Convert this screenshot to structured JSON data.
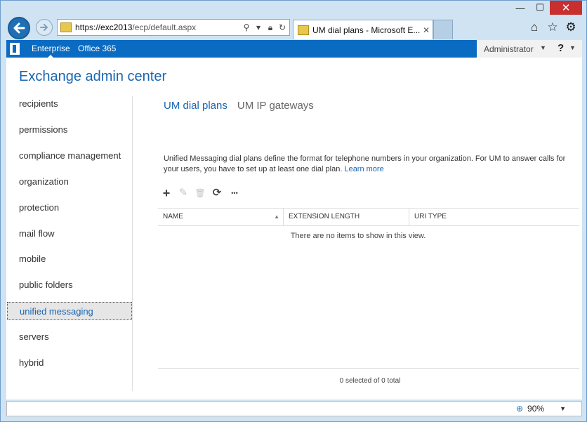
{
  "browser": {
    "window_controls": {
      "minimize": "—",
      "maximize": "☐",
      "close": "✕"
    },
    "address_bar": {
      "protocol": "https://",
      "host": "exc2013",
      "path": "/ecp/default.aspx"
    },
    "tab": {
      "title": "UM dial plans - Microsoft E...",
      "close": "✕"
    },
    "toolbar_icons": [
      "home-icon",
      "star-icon",
      "gear-icon"
    ],
    "status": {
      "zoom": "90%"
    }
  },
  "topbar": {
    "enterprise": "Enterprise",
    "office365": "Office 365",
    "user": "Administrator",
    "help": "?"
  },
  "app_title": "Exchange admin center",
  "sidebar": {
    "items": [
      {
        "label": "recipients",
        "selected": false
      },
      {
        "label": "permissions",
        "selected": false
      },
      {
        "label": "compliance management",
        "selected": false
      },
      {
        "label": "organization",
        "selected": false
      },
      {
        "label": "protection",
        "selected": false
      },
      {
        "label": "mail flow",
        "selected": false
      },
      {
        "label": "mobile",
        "selected": false
      },
      {
        "label": "public folders",
        "selected": false
      },
      {
        "label": "unified messaging",
        "selected": true
      },
      {
        "label": "servers",
        "selected": false
      },
      {
        "label": "hybrid",
        "selected": false
      }
    ]
  },
  "main": {
    "tabs": [
      {
        "label": "UM dial plans",
        "active": true
      },
      {
        "label": "UM IP gateways",
        "active": false
      }
    ],
    "description": "Unified Messaging dial plans define the format for telephone numbers in your organization. For UM to answer calls for your users, you have to set up at least one dial plan.",
    "learn_more": "Learn more",
    "toolbar": [
      {
        "name": "add-icon",
        "glyph": "+",
        "enabled": true
      },
      {
        "name": "edit-icon",
        "glyph": "✎",
        "enabled": false
      },
      {
        "name": "delete-icon",
        "glyph": "🗑",
        "enabled": false
      },
      {
        "name": "refresh-icon",
        "glyph": "⟳",
        "enabled": true
      },
      {
        "name": "more-icon",
        "glyph": "•••",
        "enabled": true
      }
    ],
    "grid": {
      "columns": [
        "NAME",
        "EXTENSION LENGTH",
        "URI TYPE"
      ],
      "sort_indicator": "▲",
      "empty_message": "There are no items to show in this view.",
      "footer": "0 selected of 0 total"
    }
  }
}
